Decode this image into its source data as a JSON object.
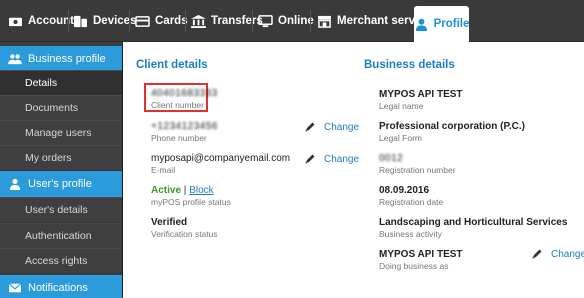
{
  "topnav": {
    "tabs": [
      {
        "label": "Accounts",
        "icon": "accounts-icon"
      },
      {
        "label": "Devices",
        "icon": "devices-icon"
      },
      {
        "label": "Cards",
        "icon": "cards-icon"
      },
      {
        "label": "Transfers",
        "icon": "transfers-icon"
      },
      {
        "label": "Online",
        "icon": "online-icon"
      },
      {
        "label": "Merchant services",
        "icon": "merchant-icon"
      },
      {
        "label": "Profile",
        "icon": "profile-icon"
      }
    ]
  },
  "sidebar": {
    "business_header": "Business profile",
    "business_items": [
      "Details",
      "Documents",
      "Manage users",
      "My orders"
    ],
    "user_header": "User's profile",
    "user_items": [
      "User's details",
      "Authentication",
      "Access rights"
    ],
    "notifications_header": "Notifications"
  },
  "client": {
    "title": "Client details",
    "client_number_value": "40401683333",
    "client_number_label": "Client number",
    "phone_value": "+1234123456",
    "phone_label": "Phone number",
    "email_value": "myposapi@companyemail.com",
    "email_label": "E-mail",
    "status_active": "Active",
    "status_sep": "|",
    "status_block": "Block",
    "status_label": "myPOS profile status",
    "verification_value": "Verified",
    "verification_label": "Verification status",
    "change_label": "Change"
  },
  "business": {
    "title": "Business details",
    "legal_name_value": "MYPOS API TEST",
    "legal_name_label": "Legal name",
    "legal_form_value": "Professional corporation (P.C.)",
    "legal_form_label": "Legal Form",
    "reg_number_value": "0012",
    "reg_number_label": "Registration number",
    "reg_date_value": "08.09.2016",
    "reg_date_label": "Registration date",
    "activity_value": "Landscaping and Horticultural Services",
    "activity_label": "Business activity",
    "dba_value": "MYPOS API TEST",
    "dba_label": "Doing business as",
    "change_label": "Change"
  },
  "colors": {
    "accent": "#2b9bdc",
    "nav_bg": "#3a3a3a",
    "sidebar_bg": "#3f3f3f",
    "link": "#1c7fc4",
    "active_status": "#3a9a2a",
    "highlight": "#e03030"
  }
}
